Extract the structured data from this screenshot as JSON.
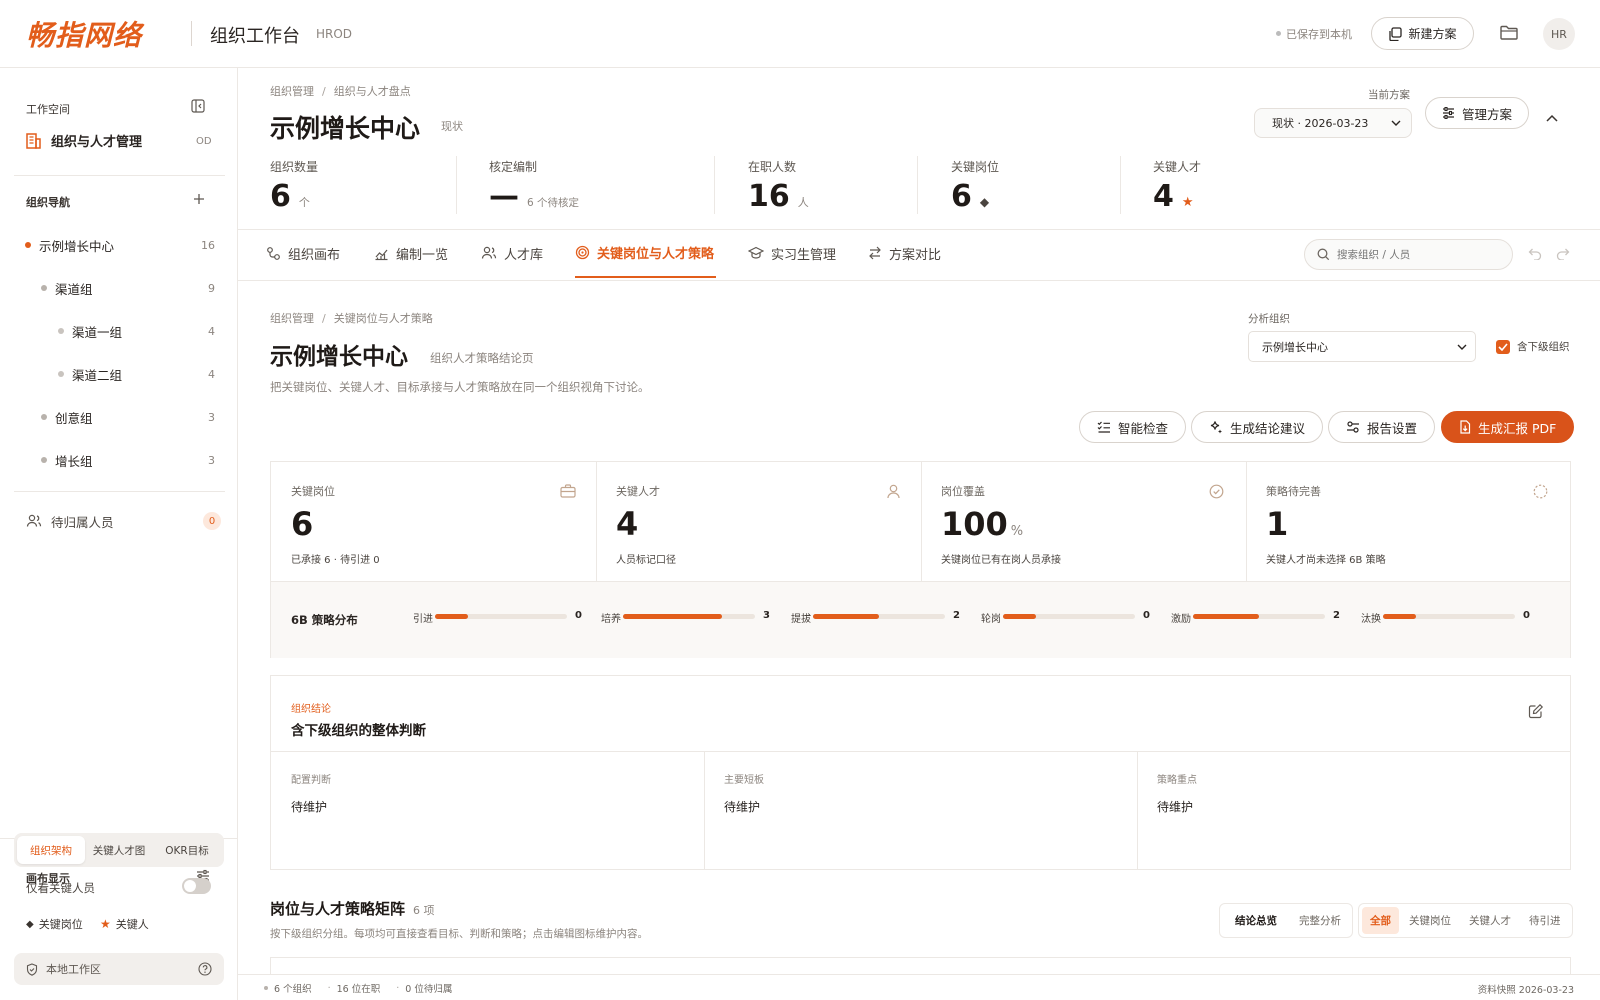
{
  "brand": {
    "logo_text": "畅指网络",
    "app_title": "组织工作台",
    "app_code": "HROD",
    "accent": "#e25d1b"
  },
  "topbar": {
    "saved_text": "已保存到本机",
    "new_button": "新建方案",
    "folder_icon": "folder-icon",
    "avatar": "HR"
  },
  "sidebar": {
    "workspace_label": "工作空间",
    "workspace_name": "组织与人才管理",
    "workspace_code": "OD",
    "nav_label": "组织导航",
    "tree": [
      {
        "label": "示例增长中心",
        "count": "16"
      },
      {
        "label": "渠道组",
        "count": "9"
      },
      {
        "label": "渠道一组",
        "count": "4"
      },
      {
        "label": "渠道二组",
        "count": "4"
      },
      {
        "label": "创意组",
        "count": "3"
      },
      {
        "label": "增长组",
        "count": "3"
      }
    ],
    "pending_label": "待归属人员",
    "pending_count": "0",
    "display_label": "画布显示",
    "segments": [
      "组织架构",
      "关键人才图",
      "OKR目标"
    ],
    "only_key_label": "仅看关键人员",
    "legend_key_post": "关键岗位",
    "legend_key_person": "关键人",
    "footer_label": "本地工作区"
  },
  "header": {
    "breadcrumb": [
      "组织管理",
      "组织与人才盘点"
    ],
    "title": "示例增长中心",
    "title_tag": "现状",
    "plan_label": "当前方案",
    "plan_value": "现状 · 2026-03-23",
    "manage_button": "管理方案",
    "stats": [
      {
        "label": "组织数量",
        "value": "6",
        "unit": "个"
      },
      {
        "label": "核定编制",
        "value": "—",
        "unit": "6 个待核定"
      },
      {
        "label": "在职人数",
        "value": "16",
        "unit": "人"
      },
      {
        "label": "关键岗位",
        "value": "6",
        "unit": "◆"
      },
      {
        "label": "关键人才",
        "value": "4",
        "unit": "★"
      }
    ]
  },
  "tabs": [
    "组织画布",
    "编制一览",
    "人才库",
    "关键岗位与人才策略",
    "实习生管理",
    "方案对比"
  ],
  "active_tab": 3,
  "search_placeholder": "搜索组织 / 人员",
  "content": {
    "breadcrumb": [
      "组织管理",
      "关键岗位与人才策略"
    ],
    "title": "示例增长中心",
    "subtitle": "组织人才策略结论页",
    "description": "把关键岗位、关键人才、目标承接与人才策略放在同一个组织视角下讨论。",
    "analysis_label": "分析组织",
    "analysis_value": "示例增长中心",
    "include_sub_label": "含下级组织",
    "include_sub_checked": true,
    "actions": [
      "智能检查",
      "生成结论建议",
      "报告设置",
      "生成汇报 PDF"
    ],
    "kpis": [
      {
        "label": "关键岗位",
        "value": "6",
        "unit": "",
        "sub": "已承接 6 · 待引进 0",
        "icon": "briefcase-icon"
      },
      {
        "label": "关键人才",
        "value": "4",
        "unit": "",
        "sub": "人员标记口径",
        "icon": "user-icon"
      },
      {
        "label": "岗位覆盖",
        "value": "100",
        "unit": "%",
        "sub": "关键岗位已有在岗人员承接",
        "icon": "check-circle-icon"
      },
      {
        "label": "策略待完善",
        "value": "1",
        "unit": "",
        "sub": "关键人才尚未选择 6B 策略",
        "icon": "dashed-circle-icon"
      }
    ],
    "strategy_label": "6B 策略分布",
    "strategy": [
      {
        "label": "引进",
        "value": 0,
        "fill": 0.25
      },
      {
        "label": "培养",
        "value": 3,
        "fill": 0.75
      },
      {
        "label": "提拔",
        "value": 2,
        "fill": 0.5
      },
      {
        "label": "轮岗",
        "value": 0,
        "fill": 0.25
      },
      {
        "label": "激励",
        "value": 2,
        "fill": 0.5
      },
      {
        "label": "汰换",
        "value": 0,
        "fill": 0.25
      }
    ],
    "conclusion_tag": "组织结论",
    "conclusion_title": "含下级组织的整体判断",
    "conclusion_cols": [
      {
        "label": "配置判断",
        "value": "待维护"
      },
      {
        "label": "主要短板",
        "value": "待维护"
      },
      {
        "label": "策略重点",
        "value": "待维护"
      }
    ],
    "matrix_title": "岗位与人才策略矩阵",
    "matrix_count": "6 项",
    "matrix_desc": "按下级组织分组。每项均可直接查看目标、判断和策略；点击编辑图标维护内容。",
    "view_toggle": [
      "结论总览",
      "完整分析"
    ],
    "filters": [
      "全部",
      "关键岗位",
      "关键人才",
      "待引进"
    ]
  },
  "status": {
    "orgs": "6 个组织",
    "active": "16 位在职",
    "pending": "0 位待归属",
    "snapshot": "资料快照 2026-03-23"
  }
}
